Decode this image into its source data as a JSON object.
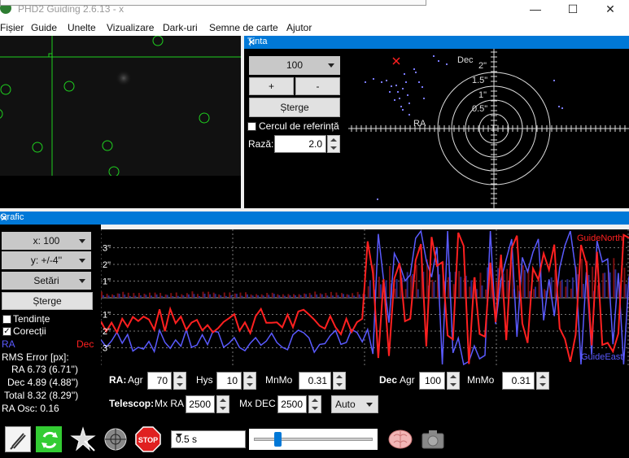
{
  "window": {
    "title": "PHD2 Guiding 2.6.13 - x",
    "minimize": "—",
    "maximize": "☐",
    "close": "✕"
  },
  "menu": [
    "Fișier",
    "Guide",
    "Unelte",
    "Vizualizare",
    "Dark-uri",
    "Semne de carte",
    "Ajutor"
  ],
  "target": {
    "title": "Ținta",
    "close": "✕",
    "zoom_value": "100",
    "plus": "+",
    "minus": "-",
    "clear": "Șterge",
    "ref_circle_label": "Cercul de referință",
    "ref_circle_checked": false,
    "radius_label": "Rază:",
    "radius_value": "2.0",
    "axis_ra": "RA",
    "axis_dec": "Dec",
    "rings": [
      "2\"",
      "1.5\"",
      "1\"",
      "0.5\""
    ]
  },
  "graph": {
    "title": "Grafic",
    "close": "✕",
    "x_scale": "x: 100",
    "y_scale": "y: +/-4''",
    "settings": "Setări",
    "clear": "Șterge",
    "trends_label": "Tendințe",
    "trends_checked": false,
    "corrections_label": "Corecții",
    "corrections_checked": true,
    "ra_label": "RA",
    "dec_label": "Dec",
    "rms_title": "RMS Error [px]:",
    "rms_ra": "RA 6.73 (6.71'')",
    "rms_dec": "Dec 4.89 (4.88'')",
    "rms_total": "Total 8.32 (8.29'')",
    "ra_osc": "RA Osc: 0.16",
    "y_ticks": [
      "3\"",
      "2\"",
      "1\"",
      "1\"",
      "2\"",
      "3\""
    ],
    "guide_north": "GuideNorth",
    "guide_east": "GuideEast",
    "colors": {
      "ra": "#5a5aff",
      "dec": "#ff2020"
    }
  },
  "controls": {
    "ra_label": "RA:",
    "agr_label": "Agr",
    "ra_agr": "70",
    "hys_label": "Hys",
    "ra_hys": "10",
    "mnmo_label": "MnMo",
    "ra_mnmo": "0.31",
    "dec_label": "Dec",
    "dec_agr_label": "Agr",
    "dec_agr": "100",
    "dec_mnmo_label": "MnMo",
    "dec_mnmo": "0.31",
    "telescope_label": "Telescop:",
    "mxra_label": "Mx RA",
    "mx_ra": "2500",
    "mxdec_label": "Mx DEC",
    "mx_dec": "2500",
    "dec_mode": "Auto"
  },
  "toolbar": {
    "exposure": "0.5 s",
    "stop_label": "STOP",
    "exposure_slider_fraction": 0.2
  }
}
